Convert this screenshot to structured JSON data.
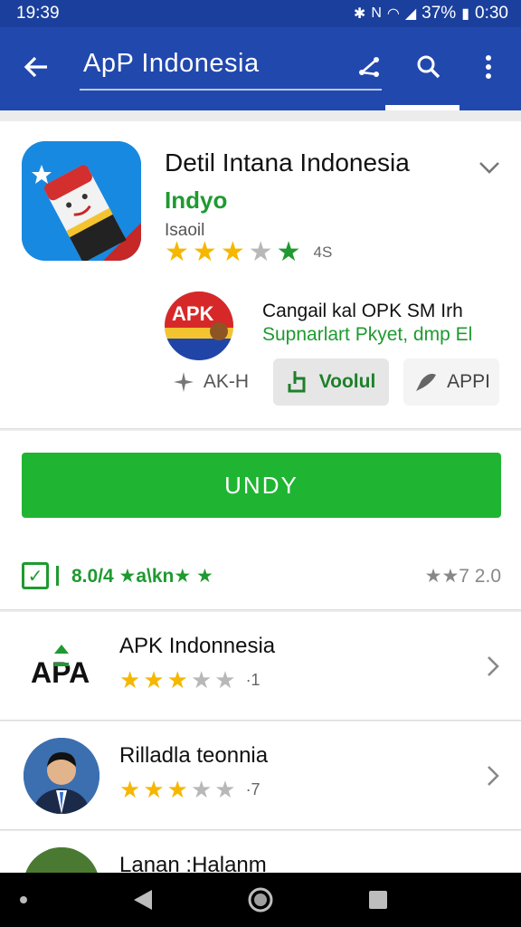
{
  "status_bar": {
    "time": "19:39",
    "battery": "37%",
    "clock_right": "0:30"
  },
  "app_bar": {
    "title": "ApP Indonesia"
  },
  "app": {
    "name": "Detil Intana Indonesia",
    "developer": "Indyo",
    "subtitle": "Isaoil",
    "rating_count": "4S",
    "stars": [
      1,
      1,
      1,
      0,
      1
    ]
  },
  "promo": {
    "badge_text": "APK",
    "line1": "Cangail kal OPK SM Irh",
    "line2": "Supnarlart Pkyet, dmp El"
  },
  "chips": [
    {
      "label": "AK-H",
      "icon": "sparkle-icon"
    },
    {
      "label": "Voolul",
      "icon": "hand-icon"
    },
    {
      "label": "APPI",
      "icon": "pen-icon"
    }
  ],
  "install": {
    "button_label": "UNDY"
  },
  "info_row": {
    "left_text": "8.0/4 ★a\\kn★ ★",
    "right_text": "★★7 2.0"
  },
  "list": [
    {
      "title": "APK Indonnesia",
      "count": "·1",
      "stars": [
        1,
        1,
        1,
        0,
        0
      ],
      "avatar": "apa-logo"
    },
    {
      "title": "Rilladla teonnia",
      "count": "·7",
      "stars": [
        1,
        1,
        1,
        0,
        0
      ],
      "avatar": "person-photo"
    },
    {
      "title": "Lanan :Halanm",
      "count": "",
      "stars": [],
      "avatar": "green-logo"
    }
  ],
  "colors": {
    "primary": "#2148ad",
    "status": "#1b3f9c",
    "accent_green": "#1fb532",
    "star": "#f5b700"
  }
}
